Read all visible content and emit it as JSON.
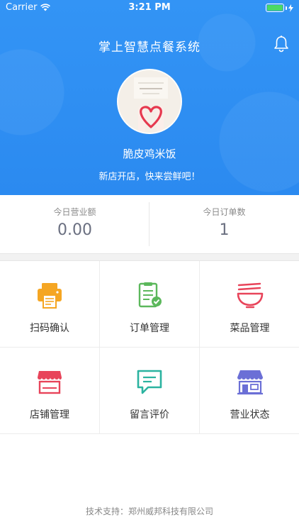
{
  "status_bar": {
    "carrier": "Carrier",
    "time": "3:21 PM"
  },
  "header": {
    "title": "掌上智慧点餐系统",
    "bell_icon": "bell-icon"
  },
  "store": {
    "name": "脆皮鸡米饭",
    "slogan": "新店开店，快来尝鲜吧！"
  },
  "stats": [
    {
      "label": "今日营业额",
      "value": "0.00"
    },
    {
      "label": "今日订单数",
      "value": "1"
    }
  ],
  "menu": [
    {
      "label": "扫码确认",
      "icon": "printer-icon"
    },
    {
      "label": "订单管理",
      "icon": "order-checklist-icon"
    },
    {
      "label": "菜品管理",
      "icon": "noodle-bowl-icon"
    },
    {
      "label": "店铺管理",
      "icon": "storefront-icon"
    },
    {
      "label": "留言评价",
      "icon": "comment-icon"
    },
    {
      "label": "营业状态",
      "icon": "shop-status-icon"
    }
  ],
  "footer": {
    "text": "技术支持：郑州威邦科技有限公司"
  },
  "colors": {
    "header_bg": "#2f8ff3",
    "orange": "#f5a623",
    "green": "#5cb85c",
    "red": "#e8445a",
    "teal": "#2bb3a0",
    "purple": "#6b6fd6"
  }
}
